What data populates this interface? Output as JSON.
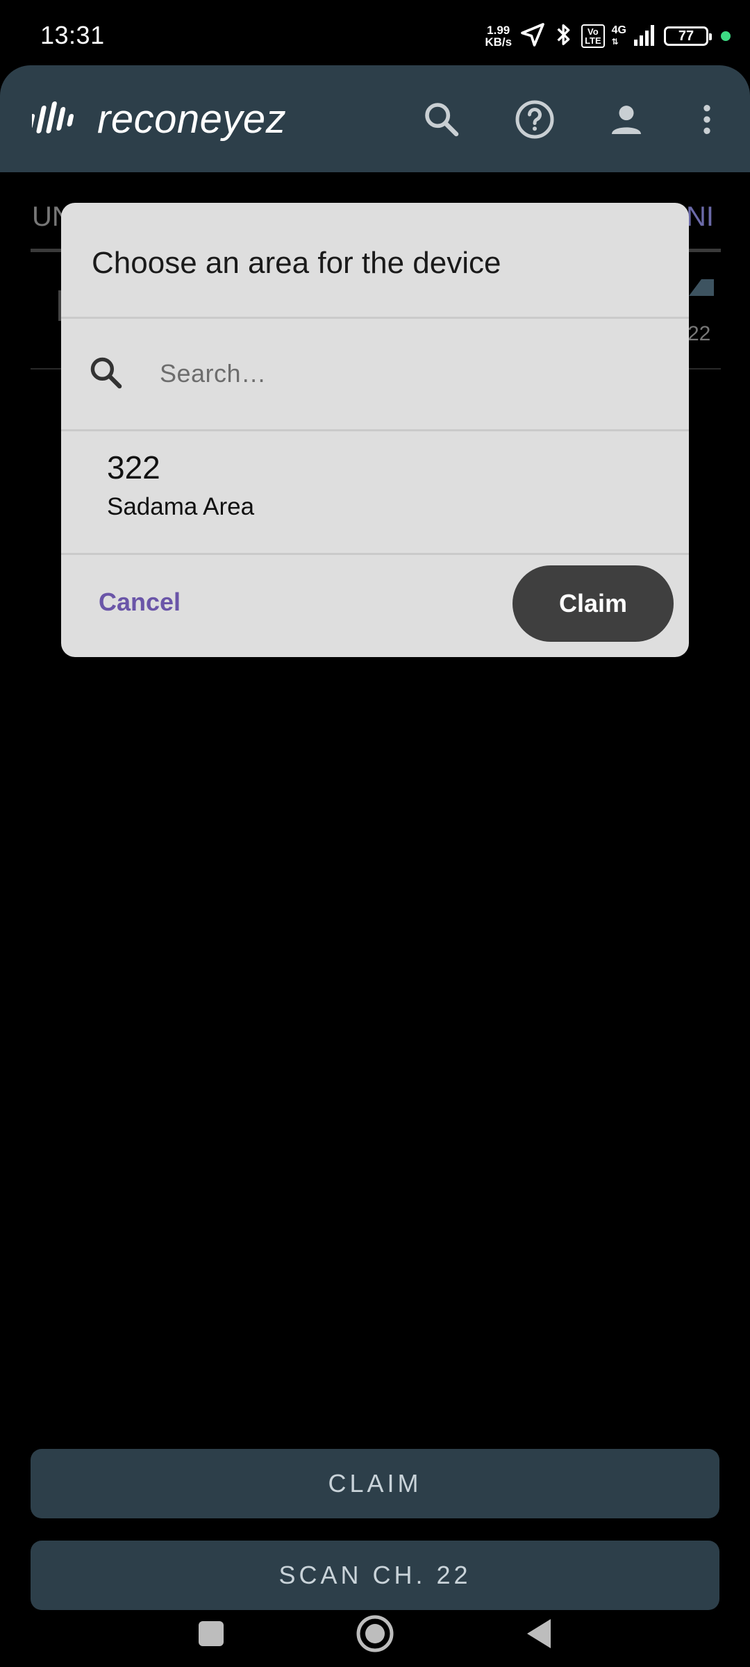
{
  "status_bar": {
    "time": "13:31",
    "net_speed_value": "1.99",
    "net_speed_unit": "KB/s",
    "volte_top": "Vo",
    "volte_bottom": "LTE",
    "network_type": "4G",
    "battery_level": "77",
    "icons": [
      "location-arrow-icon",
      "bluetooth-icon",
      "volte-icon",
      "signal-icon",
      "battery-icon"
    ]
  },
  "app_bar": {
    "brand": "reconeyez",
    "icons": [
      "search-icon",
      "help-icon",
      "account-icon",
      "more-vert-icon"
    ]
  },
  "background": {
    "tab_left_peek": "UN",
    "tab_right_peek": "NI",
    "row_number_peek": "22"
  },
  "dialog": {
    "title": "Choose an area for the device",
    "search_placeholder": "Search…",
    "areas": [
      {
        "number": "322",
        "name": "Sadama Area"
      }
    ],
    "cancel_label": "Cancel",
    "claim_label": "Claim"
  },
  "bottom_actions": {
    "claim_label": "CLAIM",
    "scan_label": "SCAN CH. 22"
  },
  "colors": {
    "app_bar": "#2d3f4a",
    "dialog_bg": "#dedede",
    "accent_purple": "#6a55a8",
    "claim_button": "#3f3f3f",
    "status_dot": "#3ddc84"
  }
}
